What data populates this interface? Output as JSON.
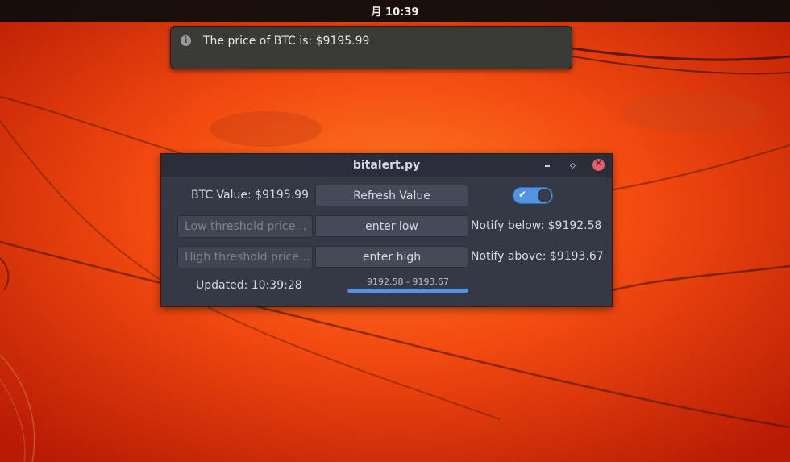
{
  "topbar": {
    "clock": "月 10:39"
  },
  "notification": {
    "icon": "info-icon",
    "message": "The price of BTC is: $9195.99"
  },
  "window": {
    "title": "bitalert.py",
    "controls": [
      "minimize-icon",
      "maximize-icon",
      "close-icon"
    ],
    "btc_value_label": "BTC Value: $9195.99",
    "refresh_button": "Refresh Value",
    "toggle": {
      "state": "on",
      "accent": "#5294e2"
    },
    "low_threshold": {
      "placeholder": "Low threshold price…",
      "value": ""
    },
    "enter_low_button": "enter low",
    "notify_below": "Notify below: $9192.58",
    "high_threshold": {
      "placeholder": "High threshold price…",
      "value": ""
    },
    "enter_high_button": "enter high",
    "notify_above": "Notify above: $9193.67",
    "updated": "Updated: 10:39:28",
    "range_label": "9192.58 - 9193.67",
    "range_progress": 1.0
  },
  "colors": {
    "window_bg": "#353945",
    "titlebar_bg": "#2b2e39",
    "button_bg": "#444a58",
    "close_button": "#e95c67",
    "notification_bg": "#3a3a36"
  }
}
